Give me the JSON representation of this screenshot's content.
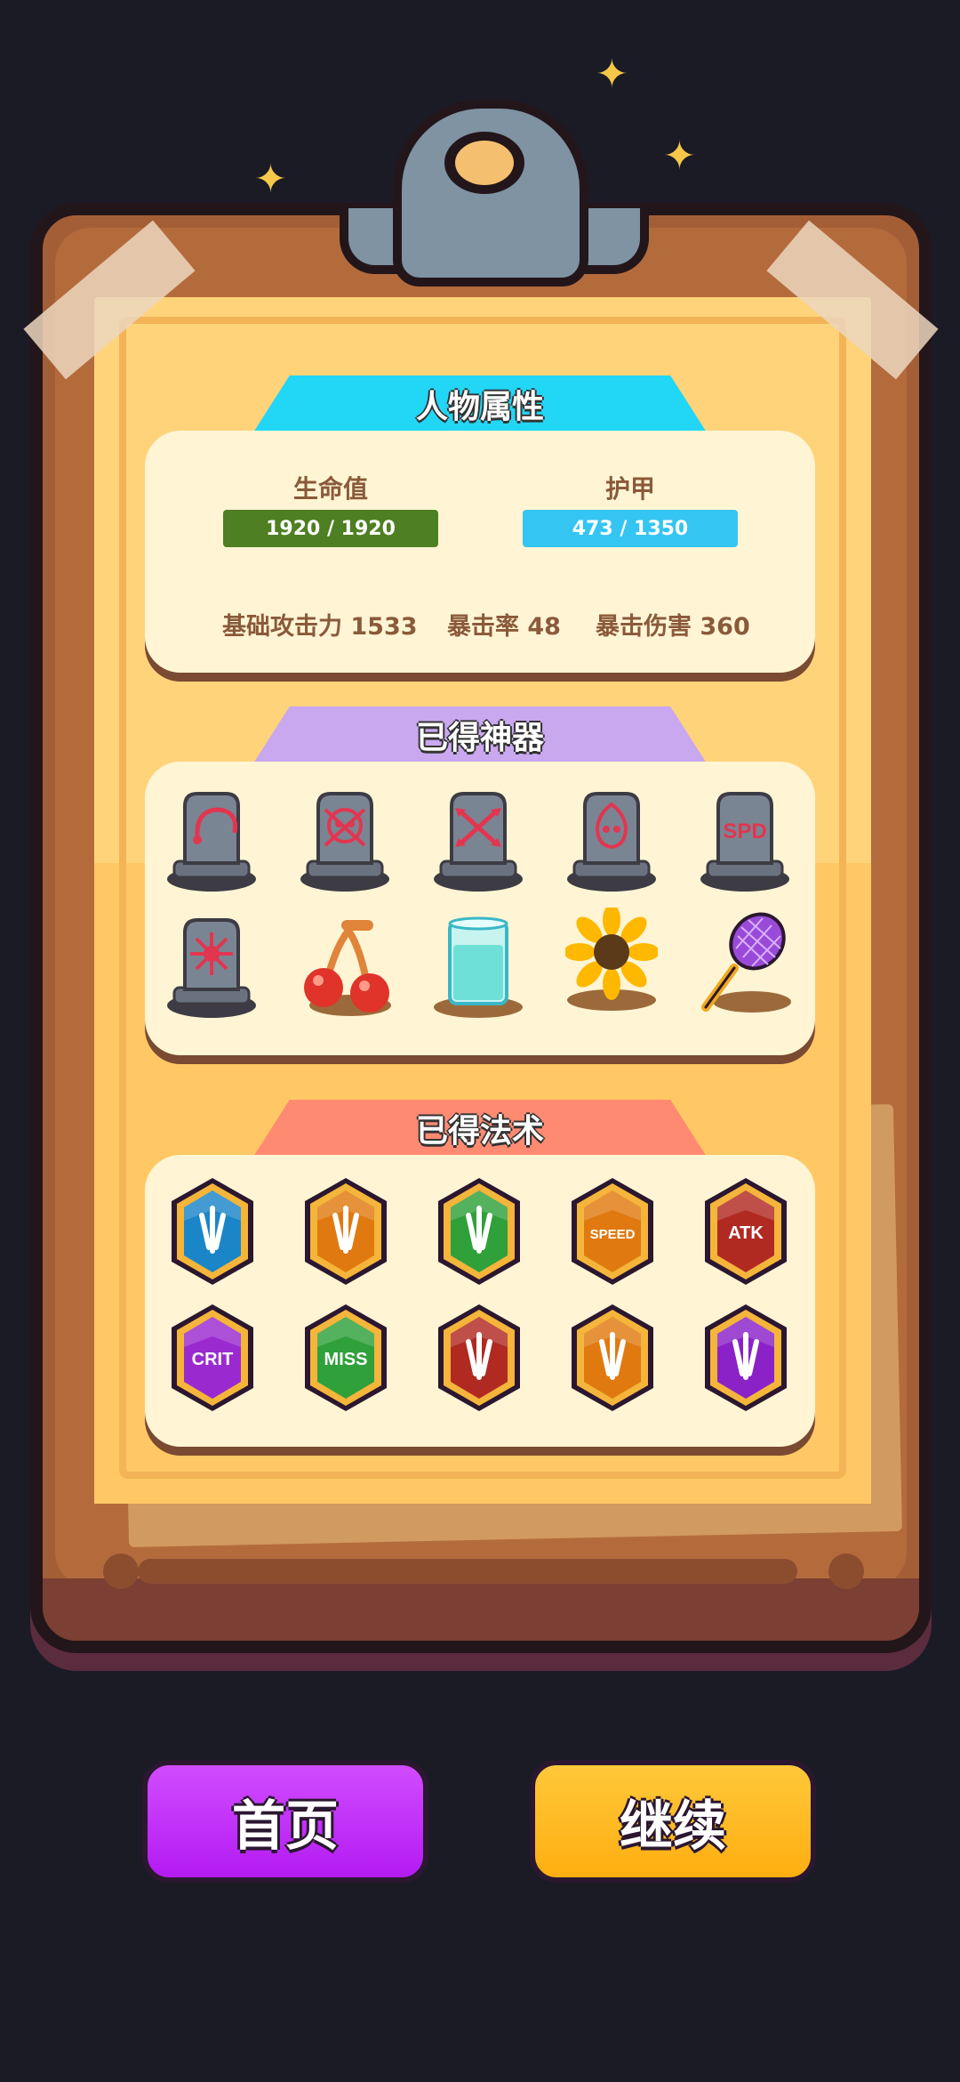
{
  "attributes": {
    "title": "人物属性",
    "hp_label": "生命值",
    "hp_value": "1920 / 1920",
    "armor_label": "护甲",
    "armor_value": "473 / 1350",
    "base_attack": "基础攻击力 1533",
    "crit_rate": "暴击率 48",
    "crit_damage": "暴击伤害 360"
  },
  "artifacts": {
    "title": "已得神器",
    "items": [
      {
        "icon": "tombstone-hook-icon"
      },
      {
        "icon": "tombstone-skull-icon"
      },
      {
        "icon": "tombstone-arrows-icon"
      },
      {
        "icon": "tombstone-fire-skull-icon"
      },
      {
        "icon": "tombstone-speed-icon",
        "text": "SPD"
      },
      {
        "icon": "tombstone-burst-icon"
      },
      {
        "icon": "cherry-icon"
      },
      {
        "icon": "water-glass-icon"
      },
      {
        "icon": "sunflower-icon"
      },
      {
        "icon": "racket-icon"
      }
    ]
  },
  "spells": {
    "title": "已得法术",
    "items": [
      {
        "icon": "spell-blue-beam-icon",
        "color": "#1a86c8"
      },
      {
        "icon": "spell-orange-burst-icon",
        "color": "#e07a10"
      },
      {
        "icon": "spell-green-skull-icon",
        "color": "#2fa03a"
      },
      {
        "icon": "spell-speed-icon",
        "color": "#e07a10",
        "text": "SPEED"
      },
      {
        "icon": "spell-atk-icon",
        "color": "#b02a22",
        "text": "ATK"
      },
      {
        "icon": "spell-crit-icon",
        "color": "#9a2ad0",
        "text": "CRIT"
      },
      {
        "icon": "spell-miss-icon",
        "color": "#2fa03a",
        "text": "MISS"
      },
      {
        "icon": "spell-red-missile-icon",
        "color": "#b02a22"
      },
      {
        "icon": "spell-swords-icon",
        "color": "#e07a10"
      },
      {
        "icon": "spell-purple-missile-icon",
        "color": "#8a22c8"
      }
    ]
  },
  "buttons": {
    "home": "首页",
    "continue": "继续"
  },
  "colors": {
    "hp_bar": "#4e7f22",
    "armor_bar": "#34c5f2",
    "attributes_header": "#22d6f6",
    "artifacts_header": "#c9a8f0",
    "spells_header": "#ff8a72",
    "home_button": "#b31bf2",
    "continue_button": "#ffae10"
  }
}
